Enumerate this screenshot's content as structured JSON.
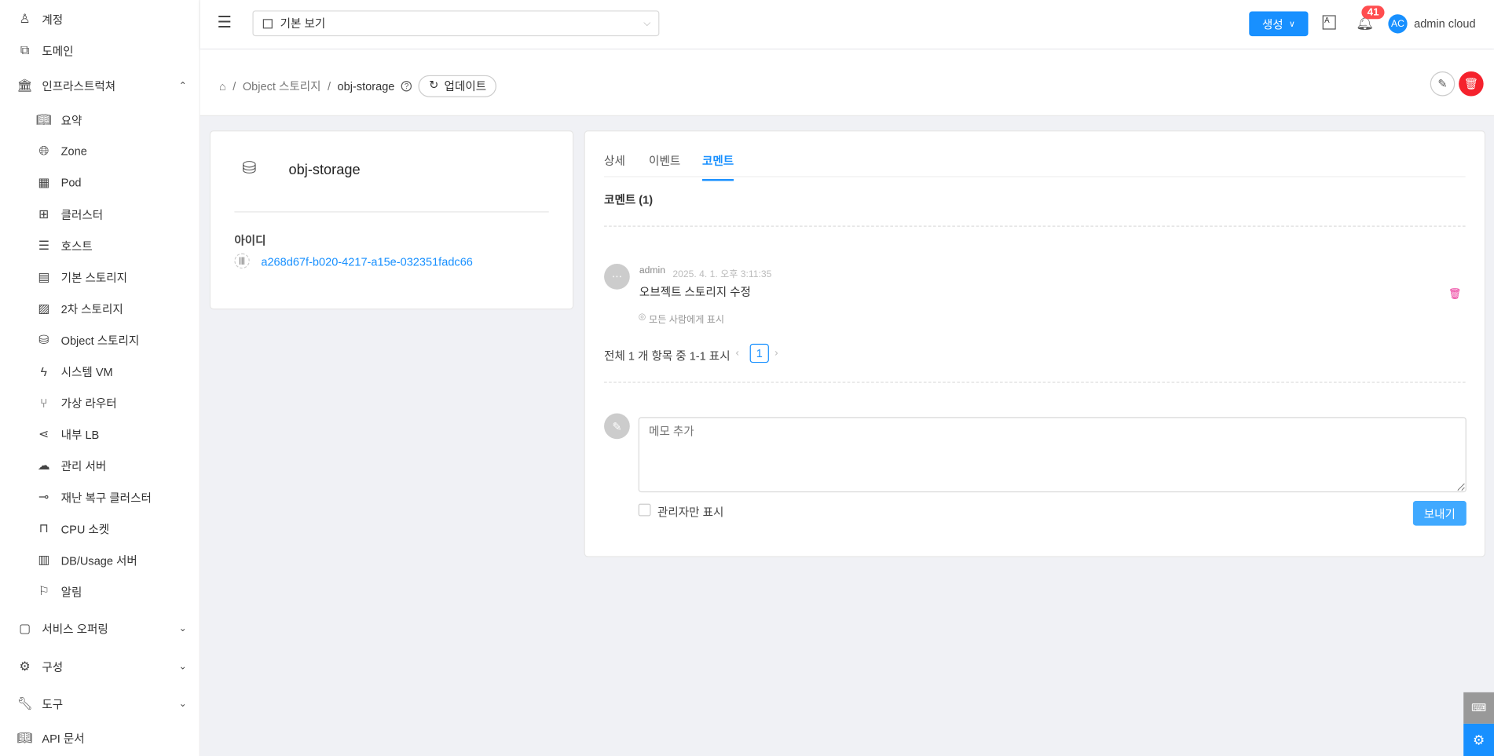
{
  "sidebar": {
    "items": [
      {
        "label": "계정",
        "icon": "user-icon"
      },
      {
        "label": "도메인",
        "icon": "domain-icon"
      },
      {
        "label": "인프라스트럭쳐",
        "icon": "bank-icon",
        "expanded": true
      },
      {
        "label": "요약",
        "icon": "book-icon"
      },
      {
        "label": "Zone",
        "icon": "globe-icon"
      },
      {
        "label": "Pod",
        "icon": "grid-icon"
      },
      {
        "label": "클러스터",
        "icon": "cluster-icon"
      },
      {
        "label": "호스트",
        "icon": "server-icon"
      },
      {
        "label": "기본 스토리지",
        "icon": "storage-icon"
      },
      {
        "label": "2차 스토리지",
        "icon": "image-icon"
      },
      {
        "label": "Object 스토리지",
        "icon": "gold-icon"
      },
      {
        "label": "시스템 VM",
        "icon": "thunder-icon"
      },
      {
        "label": "가상 라우터",
        "icon": "fork-icon"
      },
      {
        "label": "내부 LB",
        "icon": "share-icon"
      },
      {
        "label": "관리 서버",
        "icon": "cloud-server-icon"
      },
      {
        "label": "재난 복구 클러스터",
        "icon": "key-icon"
      },
      {
        "label": "CPU 소켓",
        "icon": "inbox-icon"
      },
      {
        "label": "DB/Usage 서버",
        "icon": "chart-icon"
      },
      {
        "label": "알림",
        "icon": "flag-icon"
      },
      {
        "label": "서비스 오퍼링",
        "icon": "shopping-icon"
      },
      {
        "label": "구성",
        "icon": "gear-icon"
      },
      {
        "label": "도구",
        "icon": "tool-icon"
      },
      {
        "label": "API 문서",
        "icon": "book-icon"
      }
    ]
  },
  "topbar": {
    "view_select": "기본 보기",
    "create_label": "생성",
    "notification_count": "41",
    "avatar": "AC",
    "user_name": "admin cloud"
  },
  "breadcrumb": {
    "parent": "Object 스토리지",
    "current": "obj-storage",
    "refresh_label": "업데이트"
  },
  "info": {
    "name": "obj-storage",
    "id_label": "아이디",
    "id_value": "a268d67f-b020-4217-a15e-032351fadc66"
  },
  "tabs": [
    {
      "label": "상세"
    },
    {
      "label": "이벤트"
    },
    {
      "label": "코멘트",
      "active": true
    }
  ],
  "comments": {
    "heading": "코멘트 (1)",
    "items": [
      {
        "user": "admin",
        "time": "2025. 4. 1. 오후 3:11:35",
        "text": "오브젝트 스토리지 수정",
        "visibility": "모든 사람에게 표시"
      }
    ],
    "pagination_text": "전체 1 개 항목 중 1-1 표시",
    "page": "1",
    "placeholder": "메모 추가",
    "admin_only_label": "관리자만 표시",
    "send_label": "보내기"
  },
  "colors": {
    "primary": "#1890ff",
    "danger": "#f5222d"
  }
}
